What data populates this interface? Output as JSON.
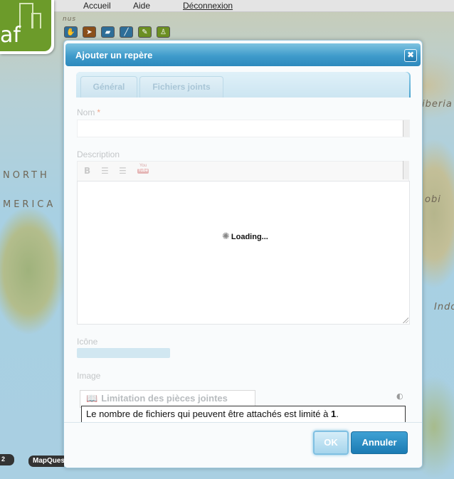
{
  "nav": {
    "accueil": "Accueil",
    "aide": "Aide",
    "deconnexion": "Déconnexion"
  },
  "logo": {
    "text": "af"
  },
  "map_labels": {
    "north": "NORTH",
    "merica": "MERICA",
    "iberia": "iberia",
    "obi": "obi",
    "indo": "Indo",
    "top_small": "nus"
  },
  "toolbar": {
    "tools": [
      {
        "name": "pan-tool",
        "icon": "hand-icon",
        "color": "#2f6e98",
        "glyph": "✋"
      },
      {
        "name": "select-tool",
        "icon": "pointer-icon",
        "color": "#8a4f1a",
        "glyph": "➤"
      },
      {
        "name": "polygon-tool",
        "icon": "polygon-icon",
        "color": "#2f6e98",
        "glyph": "▰"
      },
      {
        "name": "line-tool",
        "icon": "line-icon",
        "color": "#2f6e98",
        "glyph": "╱"
      },
      {
        "name": "pin-tool",
        "icon": "pin-icon",
        "color": "#6c8f22",
        "glyph": "✎"
      },
      {
        "name": "marker-tool",
        "icon": "marker-icon",
        "color": "#6c8f22",
        "glyph": "♙"
      }
    ]
  },
  "dialog": {
    "title": "Ajouter un repère",
    "close_glyph": "✖",
    "tabs": [
      "Général",
      "Fichiers joints"
    ],
    "fields": {
      "nom_label": "Nom",
      "nom_required": "*",
      "nom_value": "",
      "description_label": "Description",
      "editor_loading": "Loading...",
      "editor_buttons": {
        "bold": "B",
        "youtube_top": "You",
        "youtube_bottom": "Tube"
      },
      "icone_label": "Icône",
      "image_label": "Image"
    },
    "attachments": {
      "legend": "Limitation des pièces jointes",
      "message_prefix": "Le nombre de fichiers qui peuvent être attachés est limité à ",
      "limit": "1",
      "message_suffix": "."
    },
    "buttons": {
      "ok": "OK",
      "annuler": "Annuler"
    }
  },
  "map_badges": {
    "left": "2",
    "mapquest": "MapQuest"
  },
  "colors": {
    "titlebar": "#3f9bcb",
    "logo_green": "#6c9b2a",
    "button_blue": "#1b7bb3"
  }
}
